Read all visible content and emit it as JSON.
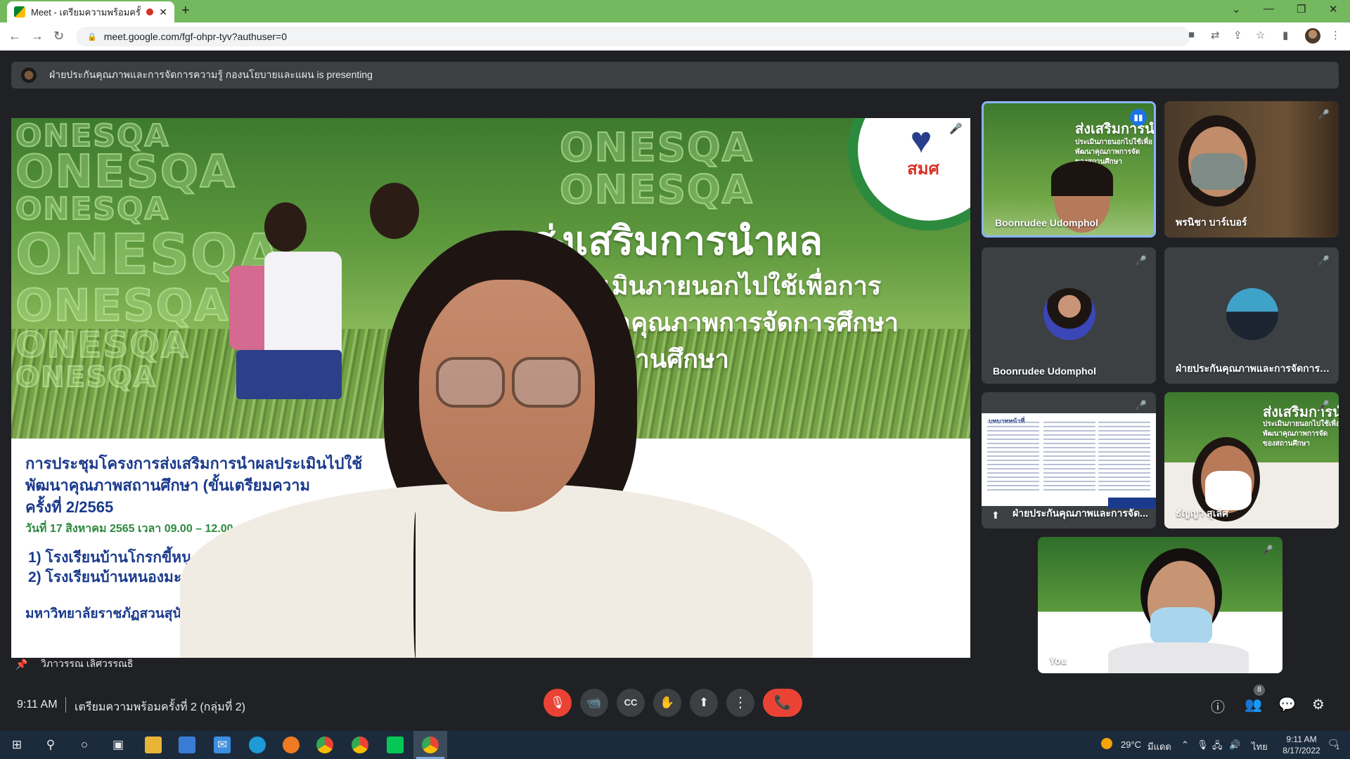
{
  "browser": {
    "tab_title": "Meet - เตรียมความพร้อมครั้งที่ 2",
    "tab_close": "✕",
    "new_tab": "+",
    "url": "meet.google.com/fgf-ohpr-tyv?authuser=0",
    "window_controls": [
      "⌄",
      "—",
      "❐",
      "✕"
    ]
  },
  "meet": {
    "presenting_banner": "ฝ่ายประกันคุณภาพและการจัดการความรู้ กองนโยบายและแผน is presenting",
    "stage_caption": "วิภาวรรณ เลิศวรรณธิ",
    "slide": {
      "watermark": "ONESQA",
      "logo_text": "สมศ",
      "title_line1": "ส่งเสริมการนำผล",
      "title_line2": "ประเมินภายนอกไปใช้เพื่อการ",
      "title_line3": "พัฒนาคุณภาพการจัดการศึกษา",
      "title_line4": "ของสถานศึกษา",
      "meeting_line1": "การประชุมโครงการส่งเสริมการนำผลประเมินไปใช้",
      "meeting_line2": "พัฒนาคุณภาพสถานศึกษา (ขั้นเตรียมความ",
      "meeting_line3": "ครั้งที่ 2/2565",
      "meeting_date": "วันที่ 17 สิงหาคม 2565 เวลา 09.00 – 12.00 น.",
      "school_1": "1)   โรงเรียนบ้านโกรกขี้หนู",
      "school_2": "2)   โรงเรียนบ้านหนองมะค่าแต้",
      "university": "มหาวิทยาลัยราชภัฏสวนสุนันทา"
    },
    "tiles": [
      {
        "name": "Boonrudee Udomphol",
        "speaking": true
      },
      {
        "name": "พรนิชา บาร์เบอร์",
        "muted": true
      },
      {
        "name": "Boonrudee Udomphol",
        "muted": true
      },
      {
        "name": "ฝ่ายประกันคุณภาพและการจัดการค...",
        "muted": true
      },
      {
        "name": "ฝ่ายประกันคุณภาพและการจัด...",
        "muted": true,
        "doc_title": "บทบาทหน้าที่"
      },
      {
        "name": "ธัญญา สุเลิศ",
        "muted": true
      },
      {
        "name": "You",
        "muted": true
      }
    ],
    "tile_slide_title": "ส่งเสริมการนำ",
    "tile_slide_sub1": "ประเมินภายนอกไปใช้เพื่อ",
    "tile_slide_sub2": "พัฒนาคุณภาพการจัด",
    "tile_slide_sub3": "ของสถานศึกษา",
    "bottom": {
      "time": "9:11 AM",
      "meeting_name": "เตรียมความพร้อมครั้งที่ 2 (กลุ่มที่ 2)",
      "participant_count": "8"
    },
    "icons": {
      "mic_off": "🎙",
      "camera": "📹",
      "captions": "CC",
      "raise_hand": "✋",
      "present": "⬆",
      "more": "⋮",
      "hangup": "📞",
      "info": "ⓘ",
      "people": "👥",
      "chat": "💬",
      "activities": "⚙"
    }
  },
  "taskbar": {
    "temperature": "29°C",
    "weather": "มีแดด",
    "lang": "ไทย",
    "time": "9:11 AM",
    "date": "8/17/2022",
    "notification_count": "1"
  },
  "colors": {
    "meet_bg": "#202124",
    "tile_bg": "#3c4043",
    "accent_blue": "#8ab4f8",
    "danger_red": "#ea4335",
    "tabbar_green": "#74b95f",
    "taskbar": "#1c2b3c"
  }
}
